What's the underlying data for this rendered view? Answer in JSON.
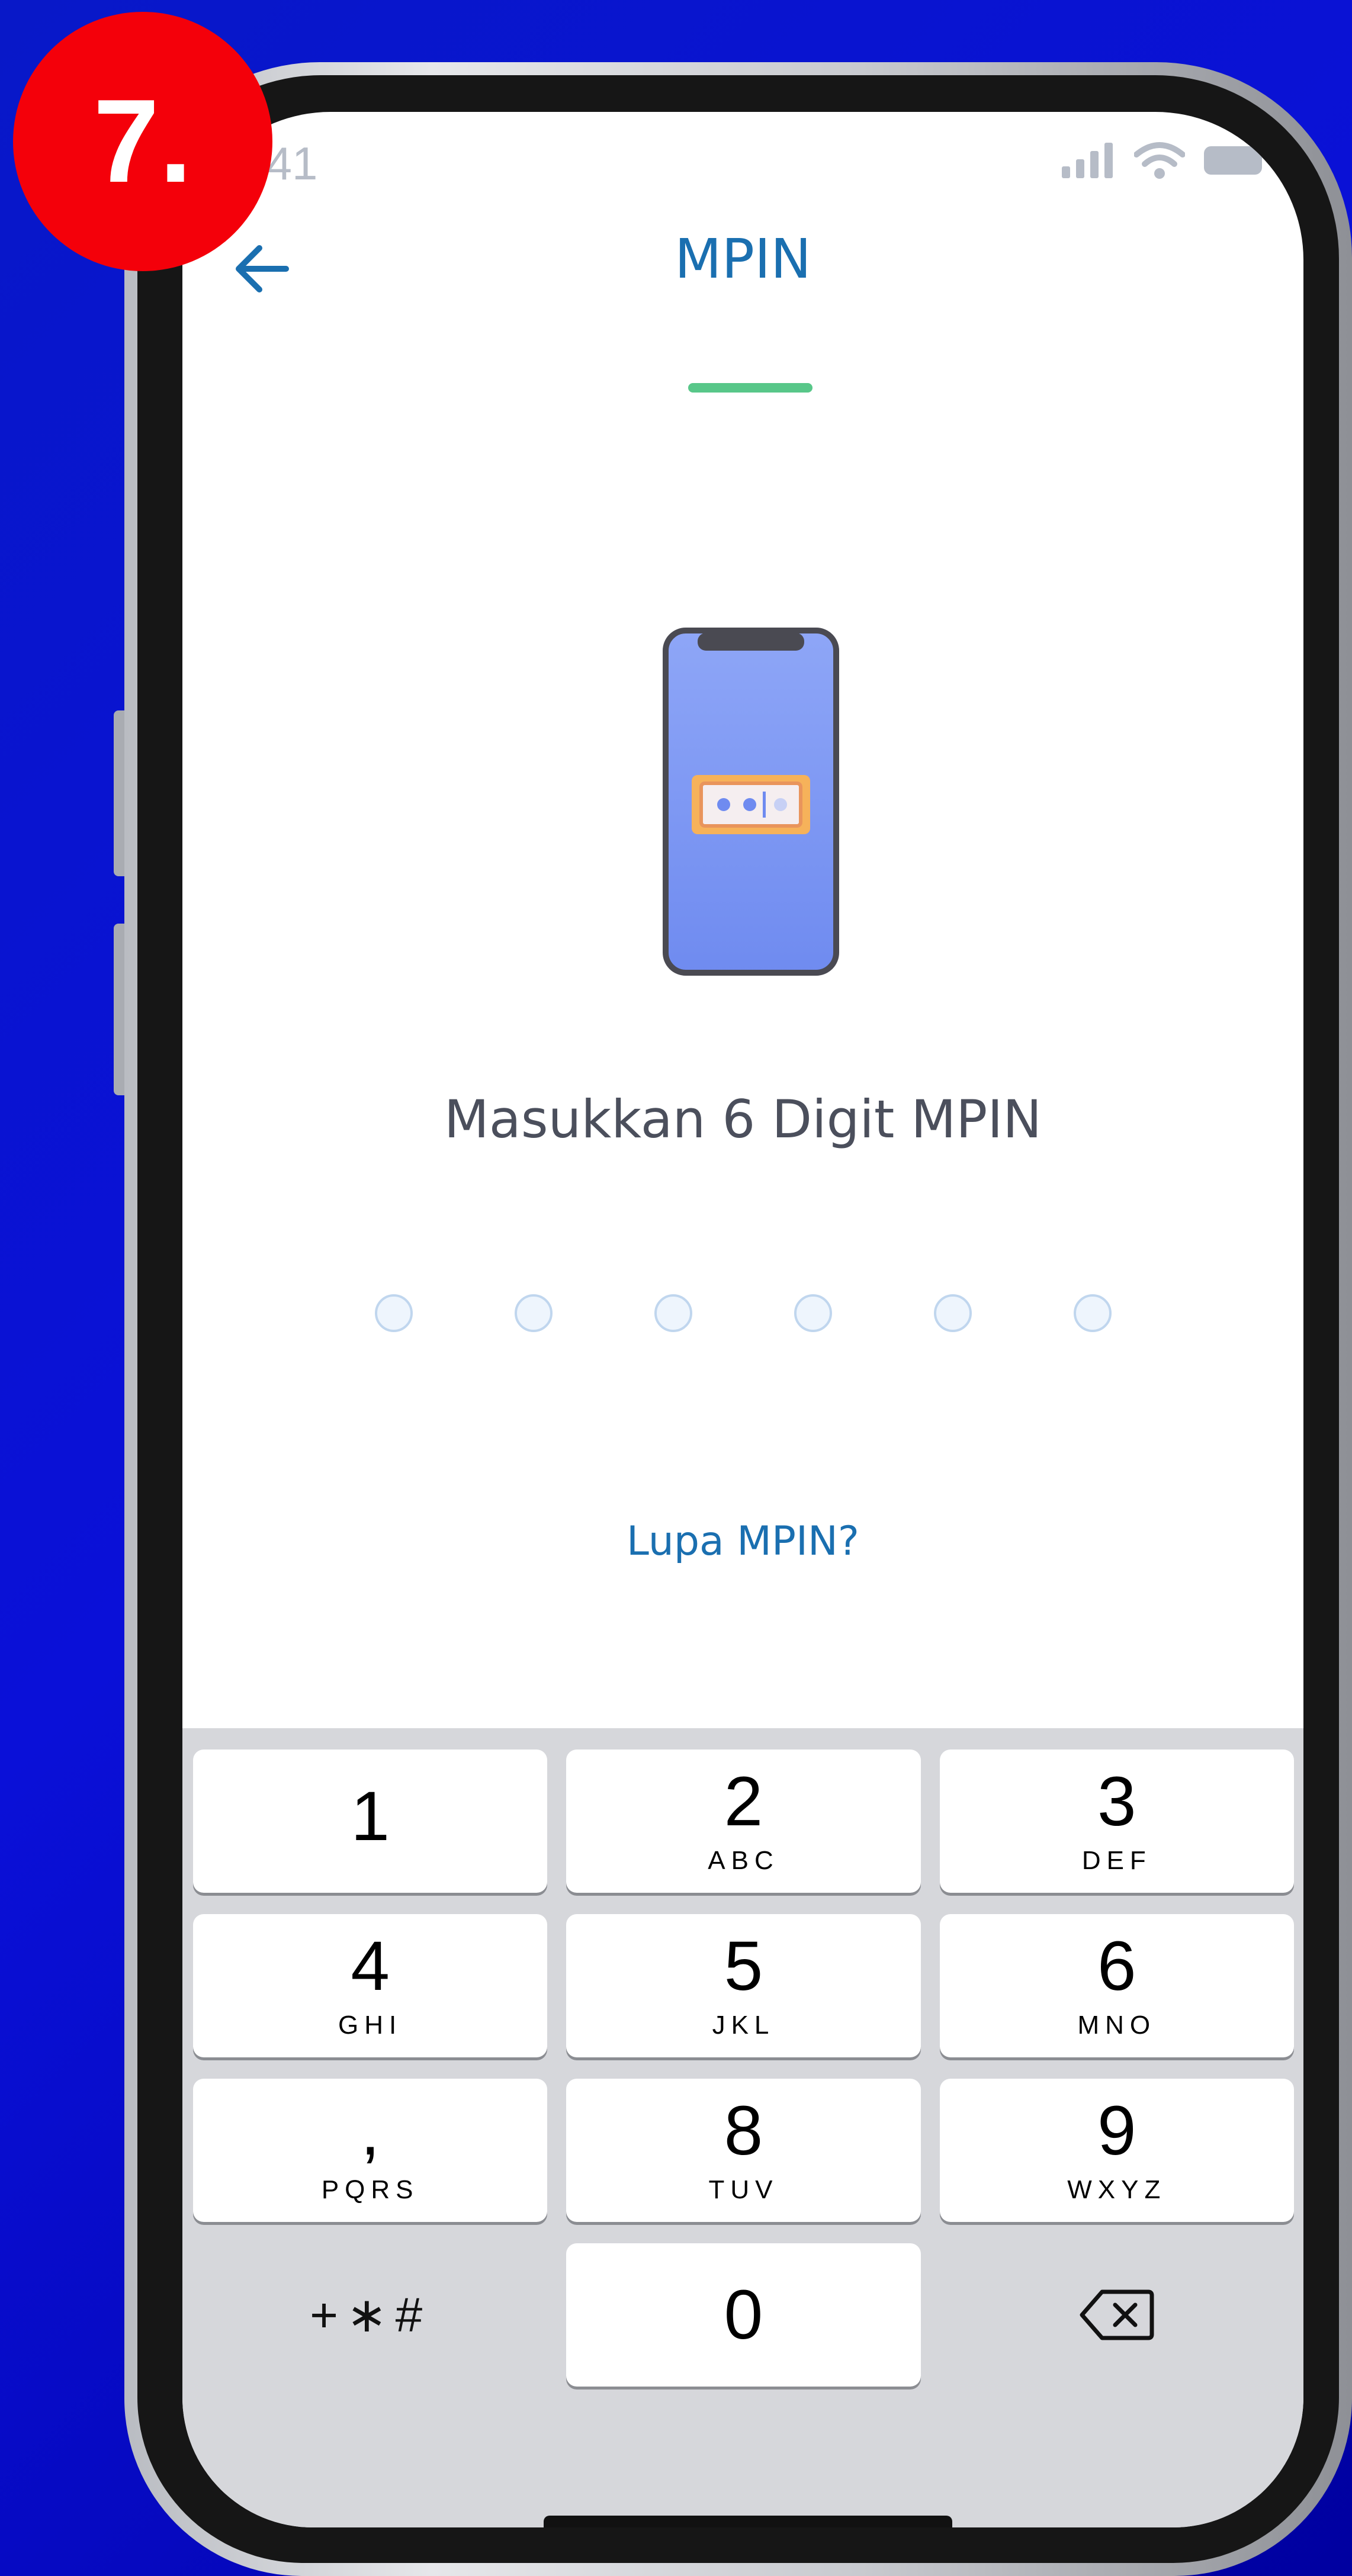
{
  "step_badge": "7.",
  "status_bar": {
    "time": ":41"
  },
  "header": {
    "title": "MPIN"
  },
  "prompt": "Masukkan 6 Digit MPIN",
  "pin_length": 6,
  "pin_entered": 0,
  "forgot_link": "Lupa MPIN?",
  "keypad": {
    "keys": [
      {
        "digit": "1",
        "letters": ""
      },
      {
        "digit": "2",
        "letters": "ABC"
      },
      {
        "digit": "3",
        "letters": "DEF"
      },
      {
        "digit": "4",
        "letters": "GHI"
      },
      {
        "digit": "5",
        "letters": "JKL"
      },
      {
        "digit": "6",
        "letters": "MNO"
      },
      {
        "digit": ",",
        "letters": "PQRS"
      },
      {
        "digit": "8",
        "letters": "TUV"
      },
      {
        "digit": "9",
        "letters": "WXYZ"
      }
    ],
    "symbols": "+∗#",
    "zero": "0"
  },
  "colors": {
    "accent": "#1a6fb0",
    "tab_indicator": "#58c789",
    "badge": "#f4000a",
    "background": "#0a10d8"
  }
}
